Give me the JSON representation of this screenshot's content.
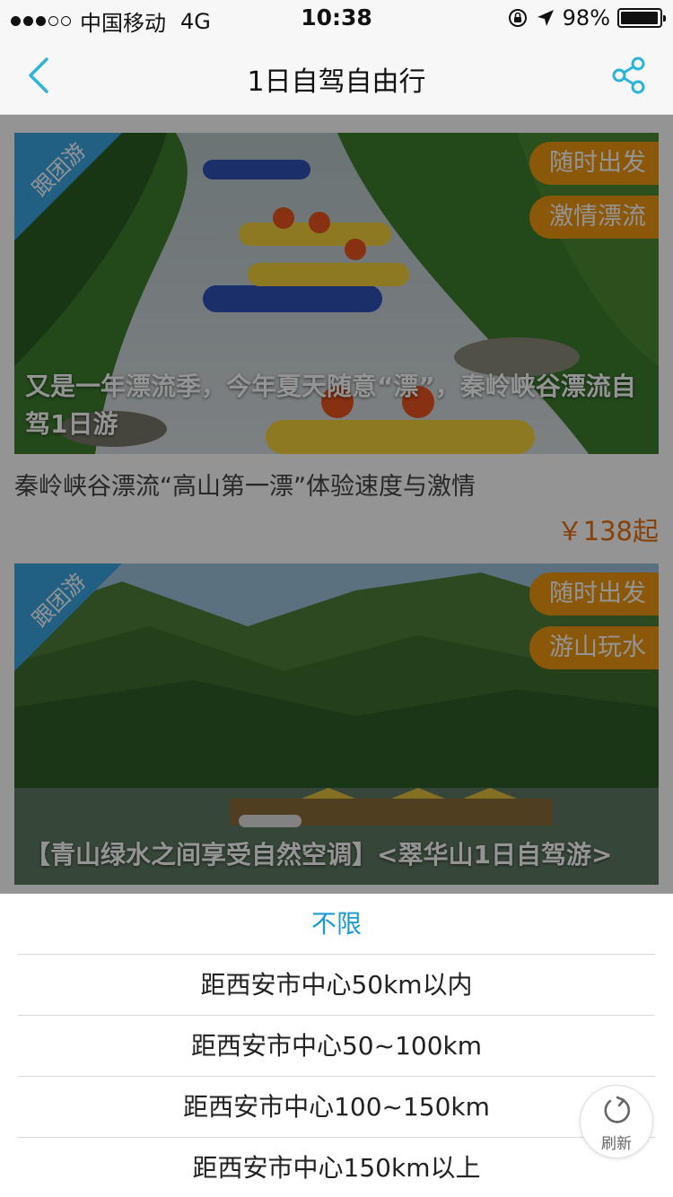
{
  "status_bar": {
    "carrier": "中国移动",
    "network": "4G",
    "time": "10:38",
    "battery": "98%",
    "battery_level": 0.98
  },
  "nav": {
    "title": "1日自驾自由行",
    "back_icon": "chevron-left-icon",
    "share_icon": "share-icon",
    "accent_color": "#2bb3d9"
  },
  "cards": [
    {
      "corner_tag": "跟团游",
      "badges": [
        "随时出发",
        "激情漂流"
      ],
      "caption": "又是一年漂流季，今年夏天随意“漂”，秦岭峡谷漂流自驾1日游",
      "subtitle": "秦岭峡谷漂流“高山第一漂”体验速度与激情",
      "price": "￥138起"
    },
    {
      "corner_tag": "跟团游",
      "badges": [
        "随时出发",
        "游山玩水"
      ],
      "caption": "【青山绿水之间享受自然空调】<翠华山1日自驾游>"
    }
  ],
  "filter_sheet": {
    "options": [
      "不限",
      "距西安市中心50km以内",
      "距西安市中心50~100km",
      "距西安市中心100~150km",
      "距西安市中心150km以上"
    ],
    "selected_color": "#1a9ad6"
  },
  "refresh": {
    "label": "刷新",
    "icon": "refresh-icon"
  },
  "colors": {
    "badge": "#f0960f",
    "corner_tag": "#3aa6e0",
    "price": "#e8710f"
  }
}
